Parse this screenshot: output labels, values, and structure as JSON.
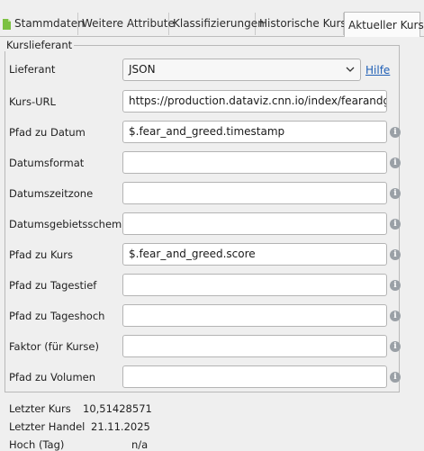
{
  "tabs": [
    {
      "label": "Stammdaten"
    },
    {
      "label": "Weitere Attribute"
    },
    {
      "label": "Klassifizierungen"
    },
    {
      "label": "Historische Kurse"
    },
    {
      "label": "Aktueller Kurs"
    }
  ],
  "group_title": "Kurslieferant",
  "fields": {
    "lieferant": {
      "label": "Lieferant",
      "value": "JSON"
    },
    "help": "Hilfe",
    "kurs_url": {
      "label": "Kurs-URL",
      "value": "https://production.dataviz.cnn.io/index/fearandgreed"
    },
    "pfad_datum": {
      "label": "Pfad zu Datum",
      "value": "$.fear_and_greed.timestamp"
    },
    "datumsformat": {
      "label": "Datumsformat",
      "value": ""
    },
    "datumszeitzone": {
      "label": "Datumszeitzone",
      "value": ""
    },
    "datumsgebietsschema": {
      "label": "Datumsgebietsschema",
      "value": ""
    },
    "pfad_kurs": {
      "label": "Pfad zu Kurs",
      "value": "$.fear_and_greed.score"
    },
    "pfad_tagestief": {
      "label": "Pfad zu Tagestief",
      "value": ""
    },
    "pfad_tageshoch": {
      "label": "Pfad zu Tageshoch",
      "value": ""
    },
    "faktor": {
      "label": "Faktor (für Kurse)",
      "value": ""
    },
    "pfad_volumen": {
      "label": "Pfad zu Volumen",
      "value": ""
    }
  },
  "stats": {
    "letzter_kurs": {
      "label": "Letzter Kurs",
      "value": "10,51428571"
    },
    "letzter_handel": {
      "label": "Letzter Handel",
      "value": "21.11.2025"
    },
    "hoch_tag": {
      "label": "Hoch (Tag)",
      "value": "n/a"
    }
  },
  "icons": {
    "info": "info-icon",
    "doc": "document-icon",
    "chevron": "chevron-down-icon"
  },
  "colors": {
    "link": "#1f5fb6",
    "doc_icon": "#7cc142",
    "info": "#9aa0a6"
  }
}
